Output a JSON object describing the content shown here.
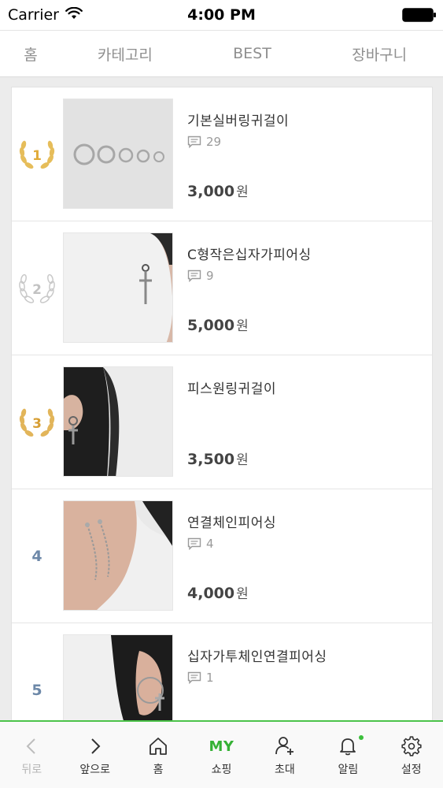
{
  "status_bar": {
    "carrier": "Carrier",
    "time": "4:00 PM"
  },
  "top_nav": {
    "tabs": [
      "홈",
      "카테고리",
      "BEST",
      "장바구니"
    ]
  },
  "products": [
    {
      "rank": "1",
      "medal": "gold",
      "title": "기본실버링귀걸이",
      "comments": "29",
      "price": "3,000",
      "currency": "원",
      "image": "silver-hoop-rings-icon"
    },
    {
      "rank": "2",
      "medal": "silver",
      "title": "C형작은십자가피어싱",
      "comments": "9",
      "price": "5,000",
      "currency": "원",
      "image": "cross-earring-icon"
    },
    {
      "rank": "3",
      "medal": "bronze",
      "title": "피스원링귀걸이",
      "comments": "",
      "price": "3,500",
      "currency": "원",
      "image": "ring-cross-earring-icon"
    },
    {
      "rank": "4",
      "medal": "",
      "title": "연결체인피어싱",
      "comments": "4",
      "price": "4,000",
      "currency": "원",
      "image": "chain-earring-icon"
    },
    {
      "rank": "5",
      "medal": "",
      "title": "십자가투체인연결피어싱",
      "comments": "1",
      "price": "",
      "currency": "",
      "image": "cross-chain-earring-icon"
    }
  ],
  "bottom_bar": {
    "back": "뒤로",
    "forward": "앞으로",
    "home": "홈",
    "my_badge": "MY",
    "shopping": "쇼핑",
    "invite": "초대",
    "alerts": "알림",
    "settings": "설정"
  },
  "colors": {
    "accent_green": "#35b135",
    "gold": "#e0b04a",
    "silver": "#c4c4c4",
    "rank_blue": "#6d88a8"
  }
}
